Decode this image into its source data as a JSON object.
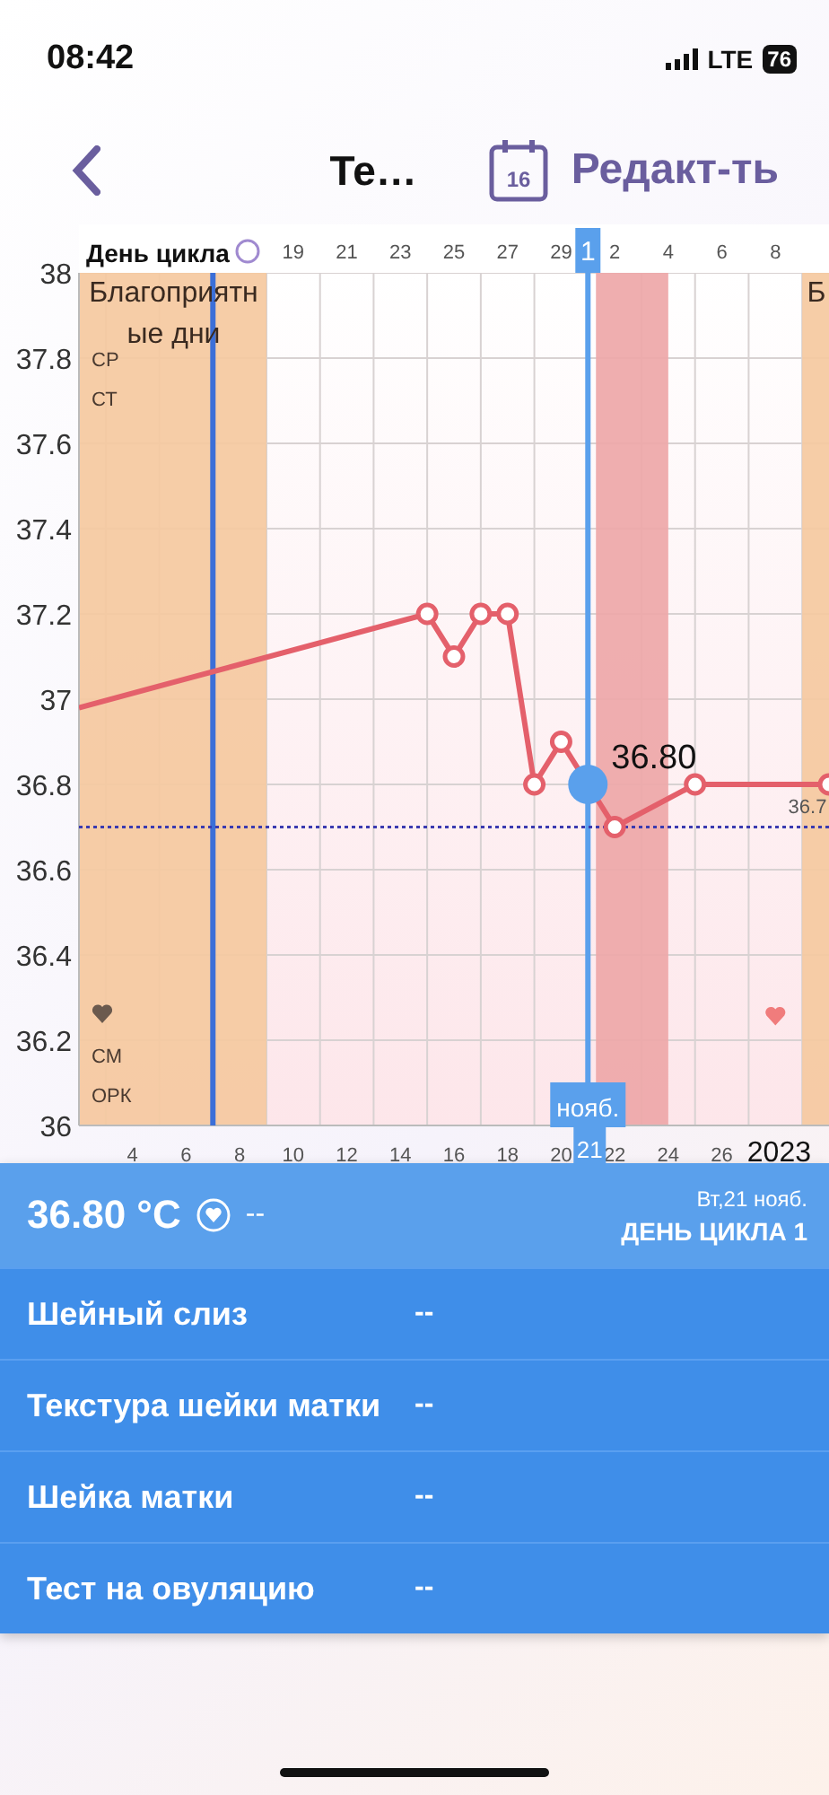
{
  "status_bar": {
    "time": "08:42",
    "network": "LTE",
    "battery": "76"
  },
  "nav": {
    "title": "Те…",
    "calendar_day": "16",
    "edit": "Редакт-ть"
  },
  "chart": {
    "axis_title": "День цикла",
    "top_codes": [
      "СР",
      "СТ"
    ],
    "bottom_codes": [
      "СМ",
      "ОРК"
    ],
    "year_label": "2023",
    "selected_month": "нояб.",
    "selected_day": "21",
    "cycle_days": [
      {
        "label": "19",
        "selected": false
      },
      {
        "label": "21",
        "selected": false
      },
      {
        "label": "23",
        "selected": false
      },
      {
        "label": "25",
        "selected": false
      },
      {
        "label": "27",
        "selected": false
      },
      {
        "label": "29",
        "selected": false
      },
      {
        "label": "1",
        "selected": true
      },
      {
        "label": "2",
        "selected": false
      },
      {
        "label": "4",
        "selected": false
      },
      {
        "label": "6",
        "selected": false
      },
      {
        "label": "8",
        "selected": false
      }
    ],
    "chart_data": {
      "type": "line",
      "grid": true,
      "x": [
        2,
        15,
        16,
        17,
        18,
        19,
        20,
        21,
        22,
        25,
        30
      ],
      "series": [
        {
          "color": "#e4606b",
          "marker": "circle",
          "values": [
            36.98,
            37.2,
            37.1,
            37.2,
            37.2,
            36.8,
            36.9,
            36.8,
            36.7,
            36.8,
            36.8
          ]
        }
      ],
      "xlim": [
        2,
        30
      ],
      "ylim": [
        36,
        38
      ],
      "yticks": [
        {
          "value": 36,
          "label": "36"
        },
        {
          "value": 36.2,
          "label": "36.2"
        },
        {
          "value": 36.4,
          "label": "36.4"
        },
        {
          "value": 36.6,
          "label": "36.6"
        },
        {
          "value": 36.8,
          "label": "36.8"
        },
        {
          "value": 37,
          "label": "37"
        },
        {
          "value": 37.2,
          "label": "37.2"
        },
        {
          "value": 37.4,
          "label": "37.4"
        },
        {
          "value": 37.6,
          "label": "37.6"
        },
        {
          "value": 37.8,
          "label": "37.8"
        },
        {
          "value": 38,
          "label": "38"
        }
      ],
      "xticks": [
        {
          "value": 4,
          "label": "4"
        },
        {
          "value": 6,
          "label": "6"
        },
        {
          "value": 8,
          "label": "8"
        },
        {
          "value": 10,
          "label": "10"
        },
        {
          "value": 12,
          "label": "12"
        },
        {
          "value": 14,
          "label": "14"
        },
        {
          "value": 16,
          "label": "16"
        },
        {
          "value": 18,
          "label": "18"
        },
        {
          "value": 20,
          "label": "20"
        },
        {
          "value": 22,
          "label": "22"
        },
        {
          "value": 24,
          "label": "24"
        },
        {
          "value": 26,
          "label": "26"
        }
      ],
      "bands": [
        {
          "axis": "x",
          "from": 2,
          "to": 9,
          "color": "#f5c9a0",
          "label": "Благоприятные дни"
        },
        {
          "axis": "x",
          "from": 29,
          "to": 30,
          "color": "#f5c9a0",
          "label": "Б"
        },
        {
          "axis": "x",
          "from": 21.3,
          "to": 24,
          "color": "#eea7a8"
        }
      ],
      "ref_lines": [
        {
          "axis": "x",
          "value": 7,
          "color": "#3b6fd8"
        },
        {
          "axis": "x",
          "value": 21,
          "color": "#5aa0ec"
        },
        {
          "axis": "y",
          "value": 36.7,
          "color": "#3a3ab0",
          "label": "36.7"
        }
      ],
      "annotations": [
        {
          "x": 21,
          "y": 36.8,
          "text": "36.80"
        }
      ]
    }
  },
  "summary": {
    "temperature": "36.80 °C",
    "note": "--",
    "date": "Вт,21 нояб.",
    "cycle_day": "ДЕНЬ ЦИКЛА 1"
  },
  "rows": [
    {
      "label": "Шейный слиз",
      "value": "--"
    },
    {
      "label": "Текстура шейки матки",
      "value": "--"
    },
    {
      "label": "Шейка матки",
      "value": "--"
    },
    {
      "label": "Тест на овуляцию",
      "value": "--"
    }
  ]
}
